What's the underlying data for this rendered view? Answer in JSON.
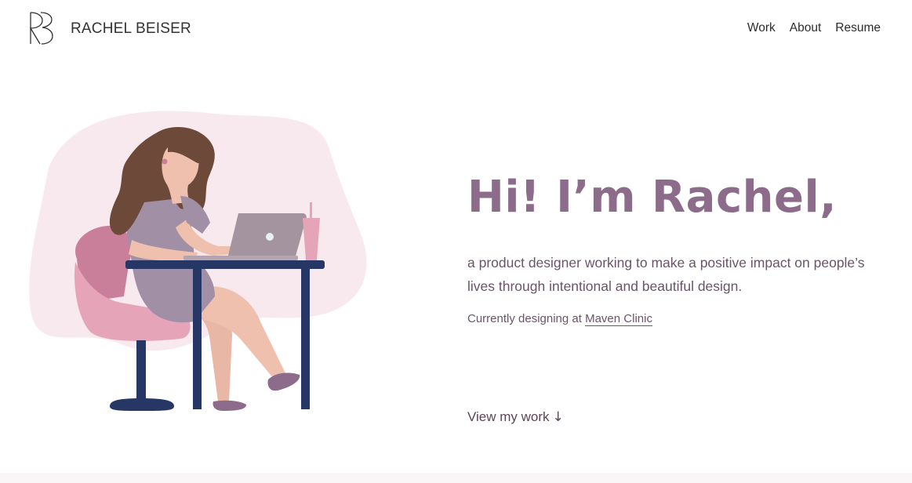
{
  "header": {
    "brand": "RACHEL BEISER",
    "nav": [
      {
        "label": "Work"
      },
      {
        "label": "About"
      },
      {
        "label": "Resume"
      }
    ]
  },
  "hero": {
    "heading": "Hi! I’m Rachel,",
    "intro": "a product designer working to make a positive impact on people’s lives through intentional and beautiful design.",
    "current_prefix": "Currently designing at",
    "current_company": "Maven Clinic",
    "cta_label": "View my work",
    "cta_arrow": "↓"
  },
  "colors": {
    "accent": "#8c6c8a",
    "blob": "#f8e9ee",
    "desk": "#263766",
    "chair": "#e6a4b9",
    "dress": "#a18fa6",
    "hair": "#6d4939",
    "skin": "#efc0ae"
  },
  "icons": {
    "logo": "rb-monogram-logo",
    "cta": "arrow-down-icon"
  }
}
